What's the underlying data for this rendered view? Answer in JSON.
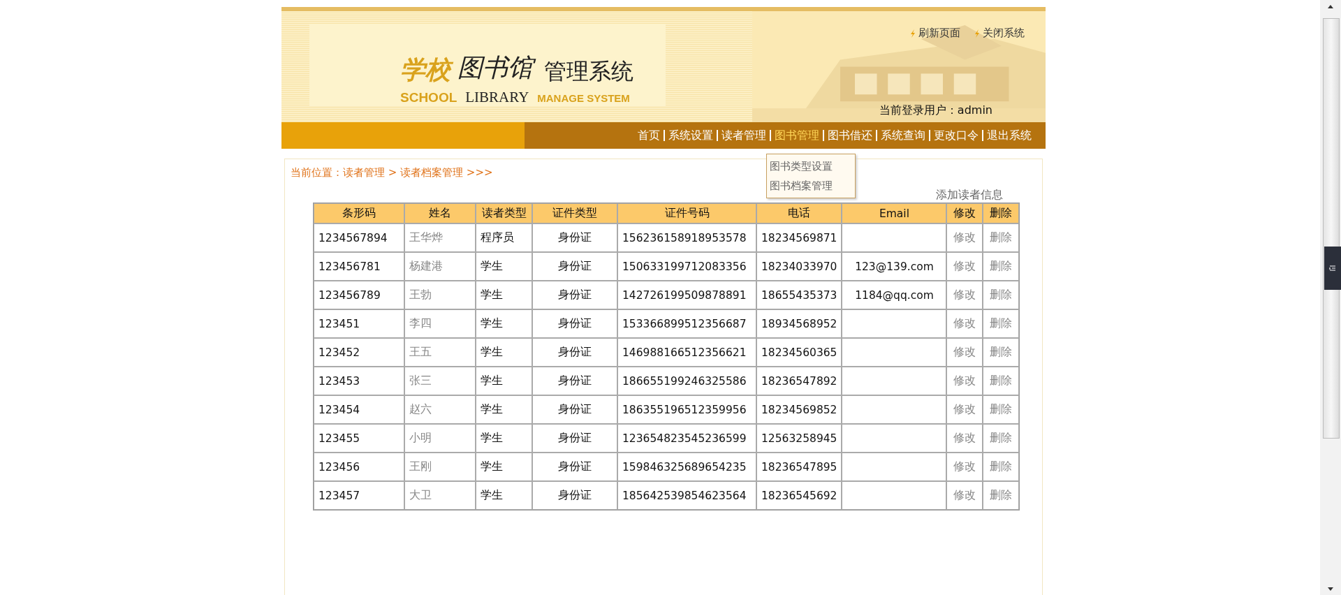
{
  "header": {
    "links": [
      "刷新页面",
      "关闭系统"
    ],
    "logo": {
      "school_cn": "学校",
      "library_cn": "图书馆",
      "manage_cn": "管理系统",
      "school_en": "SCHOOL",
      "library_en": "LIBRARY",
      "manage_en": "MANAGE SYSTEM"
    },
    "current_user": "当前登录用户：admin"
  },
  "nav": {
    "items": [
      {
        "label": "首页",
        "selected": false
      },
      {
        "label": "系统设置",
        "selected": false
      },
      {
        "label": "读者管理",
        "selected": false
      },
      {
        "label": "图书管理",
        "selected": true
      },
      {
        "label": "图书借还",
        "selected": false
      },
      {
        "label": "系统查询",
        "selected": false
      },
      {
        "label": "更改口令",
        "selected": false
      },
      {
        "label": "退出系统",
        "selected": false
      }
    ],
    "dropdown": [
      "图书类型设置",
      "图书档案管理"
    ]
  },
  "breadcrumb": "当前位置：读者管理 > 读者档案管理 >>>",
  "add_link": "添加读者信息",
  "table": {
    "columns": [
      "条形码",
      "姓名",
      "读者类型",
      "证件类型",
      "证件号码",
      "电话",
      "Email",
      "修改",
      "删除"
    ],
    "rows": [
      {
        "barcode": "1234567894",
        "name": "王华烨",
        "reader_type": "程序员",
        "id_type": "身份证",
        "id_number": "156236158918953578",
        "phone": "18234569871",
        "email": "",
        "edit": "修改",
        "delete": "删除"
      },
      {
        "barcode": "123456781",
        "name": "杨建港",
        "reader_type": "学生",
        "id_type": "身份证",
        "id_number": "150633199712083356",
        "phone": "18234033970",
        "email": "123@139.com",
        "edit": "修改",
        "delete": "删除"
      },
      {
        "barcode": "123456789",
        "name": "王勃",
        "reader_type": "学生",
        "id_type": "身份证",
        "id_number": "142726199509878891",
        "phone": "18655435373",
        "email": "1184@qq.com",
        "edit": "修改",
        "delete": "删除"
      },
      {
        "barcode": "123451",
        "name": "李四",
        "reader_type": "学生",
        "id_type": "身份证",
        "id_number": "153366899512356687",
        "phone": "18934568952",
        "email": "",
        "edit": "修改",
        "delete": "删除"
      },
      {
        "barcode": "123452",
        "name": "王五",
        "reader_type": "学生",
        "id_type": "身份证",
        "id_number": "146988166512356621",
        "phone": "18234560365",
        "email": "",
        "edit": "修改",
        "delete": "删除"
      },
      {
        "barcode": "123453",
        "name": "张三",
        "reader_type": "学生",
        "id_type": "身份证",
        "id_number": "186655199246325586",
        "phone": "18236547892",
        "email": "",
        "edit": "修改",
        "delete": "删除"
      },
      {
        "barcode": "123454",
        "name": "赵六",
        "reader_type": "学生",
        "id_type": "身份证",
        "id_number": "186355196512359956",
        "phone": "18234569852",
        "email": "",
        "edit": "修改",
        "delete": "删除"
      },
      {
        "barcode": "123455",
        "name": "小明",
        "reader_type": "学生",
        "id_type": "身份证",
        "id_number": "123654823545236599",
        "phone": "12563258945",
        "email": "",
        "edit": "修改",
        "delete": "删除"
      },
      {
        "barcode": "123456",
        "name": "王刚",
        "reader_type": "学生",
        "id_type": "身份证",
        "id_number": "159846325689654235",
        "phone": "18236547895",
        "email": "",
        "edit": "修改",
        "delete": "删除"
      },
      {
        "barcode": "123457",
        "name": "大卫",
        "reader_type": "学生",
        "id_type": "身份证",
        "id_number": "185642539854623564",
        "phone": "18236545692",
        "email": "",
        "edit": "修改",
        "delete": "删除"
      }
    ]
  }
}
